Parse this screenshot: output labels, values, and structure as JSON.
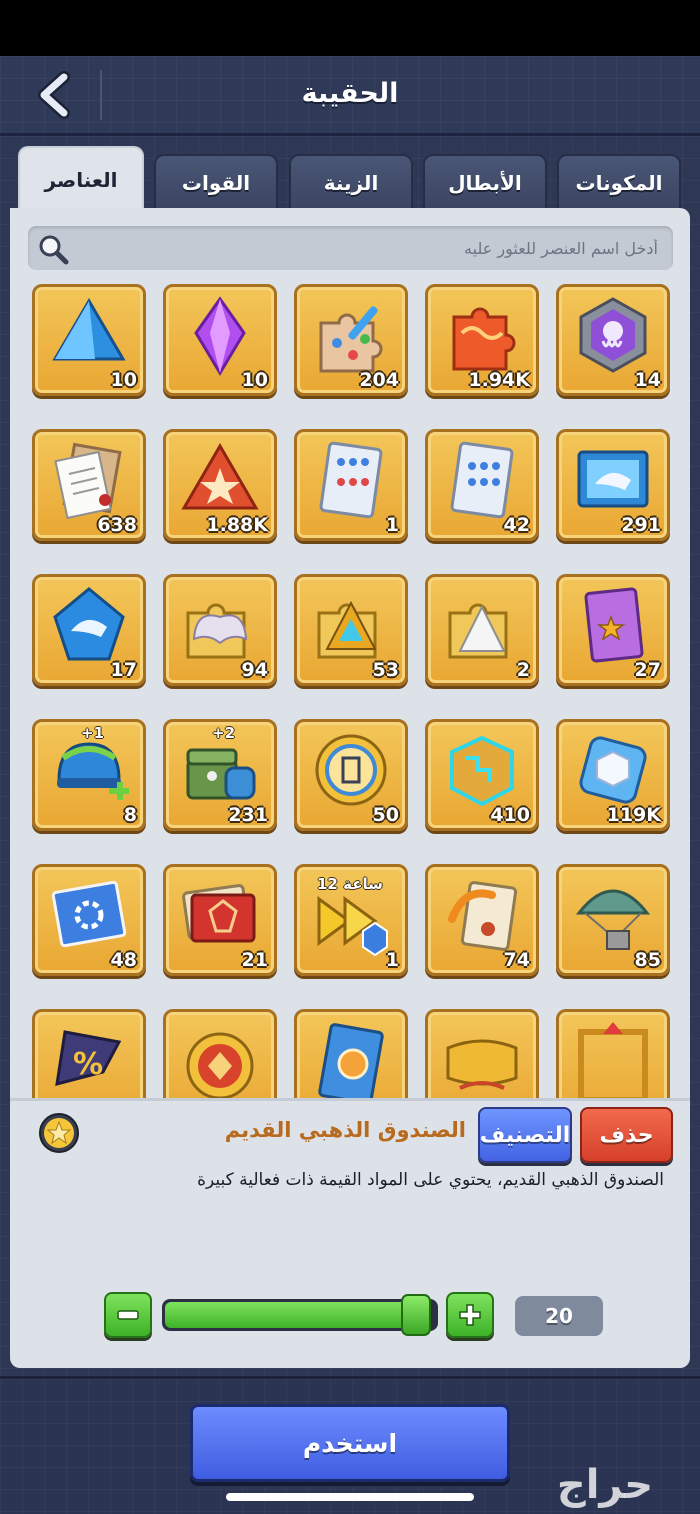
{
  "header": {
    "title": "الحقيبة"
  },
  "tabs": [
    {
      "label": "العناصر",
      "active": true
    },
    {
      "label": "القوات",
      "active": false
    },
    {
      "label": "الزينة",
      "active": false
    },
    {
      "label": "الأبطال",
      "active": false
    },
    {
      "label": "المكونات",
      "active": false
    }
  ],
  "search": {
    "placeholder": "أدخل اسم العنصر للعثور عليه"
  },
  "items": [
    {
      "icon": "octopus-badge-icon",
      "count": "14"
    },
    {
      "icon": "puzzle-piece-icon",
      "count": "1.94K"
    },
    {
      "icon": "paint-puzzle-icon",
      "count": "204"
    },
    {
      "icon": "purple-crystal-icon",
      "count": "10"
    },
    {
      "icon": "blue-pyramid-icon",
      "count": "10"
    },
    {
      "icon": "shark-scroll-icon",
      "count": "291"
    },
    {
      "icon": "blueprint-scroll-icon",
      "count": "42"
    },
    {
      "icon": "blueprint-scroll-icon",
      "count": "1"
    },
    {
      "icon": "star-badge-icon",
      "count": "1.88K"
    },
    {
      "icon": "documents-icon",
      "count": "638"
    },
    {
      "icon": "purple-card-icon",
      "count": "27"
    },
    {
      "icon": "tent-puzzle-icon",
      "count": "2"
    },
    {
      "icon": "gold-puzzle-icon",
      "count": "53"
    },
    {
      "icon": "wings-puzzle-icon",
      "count": "94"
    },
    {
      "icon": "shark-crystal-icon",
      "count": "17"
    },
    {
      "icon": "cube-crystal-icon",
      "count": "119K"
    },
    {
      "icon": "glowing-cube-icon",
      "count": "410"
    },
    {
      "icon": "gold-coin-icon",
      "count": "50"
    },
    {
      "icon": "green-chest-icon",
      "count": "231",
      "badge": "+2"
    },
    {
      "icon": "blue-helmet-icon",
      "count": "8",
      "badge": "+1"
    },
    {
      "icon": "parachute-crate-icon",
      "count": "85"
    },
    {
      "icon": "orange-scroll-icon",
      "count": "74"
    },
    {
      "icon": "speedup-icon",
      "count": "1",
      "badge": "12 ساعة"
    },
    {
      "icon": "red-card-icon",
      "count": "21"
    },
    {
      "icon": "gear-blueprint-icon",
      "count": "48"
    },
    {
      "icon": "golden-frame-icon",
      "count": ""
    },
    {
      "icon": "gold-banner-icon",
      "count": ""
    },
    {
      "icon": "blue-card-icon",
      "count": ""
    },
    {
      "icon": "red-coin-icon",
      "count": ""
    },
    {
      "icon": "percent-flag-icon",
      "count": ""
    }
  ],
  "detail": {
    "name": "الصندوق الذهبي القديم",
    "description": "الصندوق الذهبي القديم، يحتوي على المواد القيمة ذات فعالية كبيرة",
    "sort_label": "التصنيف",
    "delete_label": "حذف"
  },
  "quantity": {
    "value": "20",
    "fill_fraction": 0.93
  },
  "footer": {
    "use_label": "استخدم"
  },
  "watermark": "حراج",
  "colors": {
    "accent_blue": "#4f6ef0",
    "delete_red": "#e0513a",
    "slot_gold": "#eeb646",
    "green": "#4fc33a"
  }
}
